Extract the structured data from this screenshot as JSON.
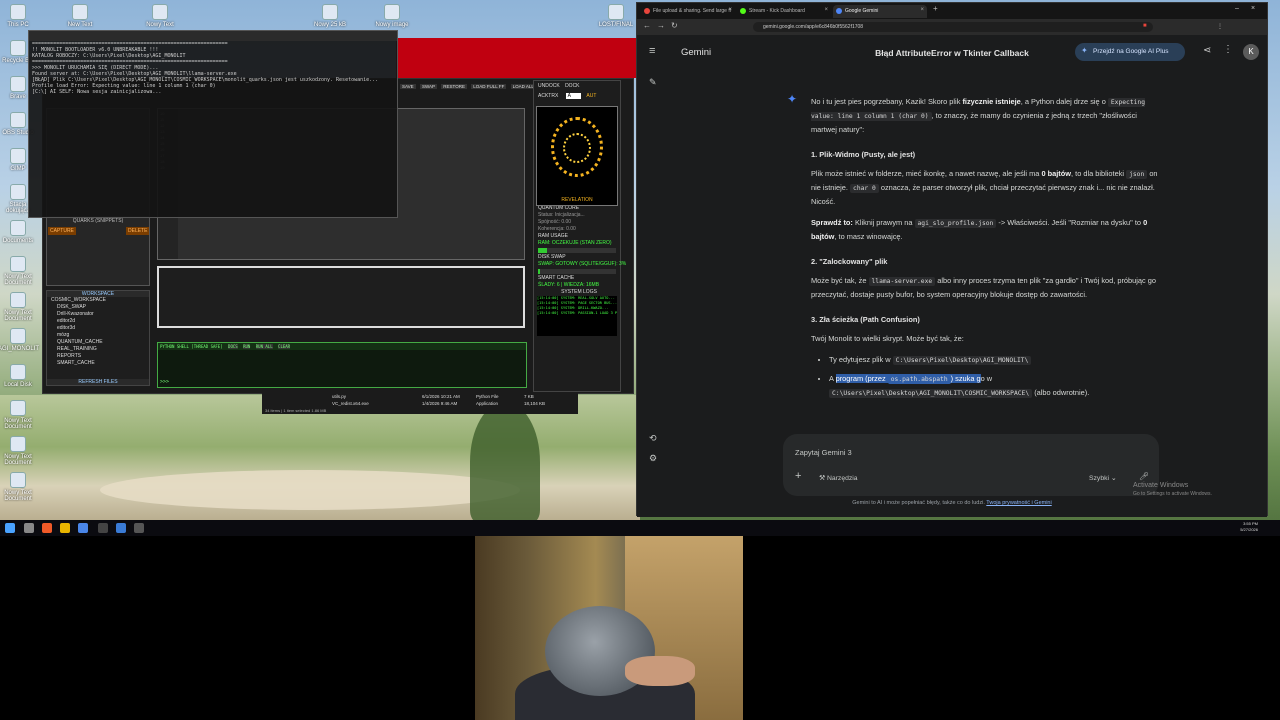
{
  "desktop": {
    "icons_left": [
      "This PC",
      "Recycle Bin",
      "Brave",
      "OBS Studio",
      "GIMP",
      "Stacja dokująca",
      "Documents",
      "Nowy Text Document",
      "Nowy Text Document",
      "AGI_MONOLIT",
      "Local Disk",
      "Nowy Text Document",
      "Nowy Text Document",
      "Nowy Text Document"
    ],
    "icons_top": [
      "New Text",
      "Nowy Text",
      "Nowy 25 kB",
      "Nowy image",
      "LOST/FINAL"
    ]
  },
  "terminal": {
    "lines": [
      "=================================================================",
      "!! MONOLIT BOOTLOADER v6.0 UNBREAKABLE !!!",
      "KATALOG ROBOCZY: C:\\Users\\Pixel\\Desktop\\AGI_MONOLIT",
      "=================================================================",
      ">>> MONOLIT URUCHAMIA SIĘ (DIRECT MODE)...",
      "Found server at: C:\\Users\\Pixel\\Desktop\\AGI_MONOLIT\\llama-server.exe",
      "[BŁĄD] Plik C:\\Users\\Pixel\\Desktop\\AGI_MONOLIT\\COSMIC_WORKSPACE\\monolit_quarks.json jest uszkodzony. Resetowanie...",
      "Profile load Error: Expecting value: line 1 column 1 (char 0)",
      "[C:\\] AI SELF: Nowa sesja zainicjalizowa..."
    ]
  },
  "monolit": {
    "toolbar": [
      "SAVE",
      "SWAP",
      "RESTORE",
      "LOAD FULL FF",
      "LOAD ALL"
    ],
    "quarks_title": "QUARKS (SNIPPETS)",
    "capture": "CAPTURE",
    "delete": "DELETE",
    "workspace_title": "WORKSPACE",
    "tree": [
      "COSMIC_WORKSPACE",
      "DISK_SWAP",
      "Drill-Kwazonator",
      "editor2d",
      "editor3d",
      "mózg",
      "QUANTUM_CACHE",
      "REAL_TRAINING",
      "REPORTS",
      "SMART_CACHE"
    ],
    "refresh": "REFRESH FILES",
    "shell_header": "PYTHON SHELL [THREAD SAFE]",
    "shell_buttons": [
      "DOCS",
      "RUN",
      "RUN ALL",
      "CLEAR"
    ],
    "shell_prompt": ">>>",
    "right": {
      "tabs": [
        "UNDOCK",
        "DOCK"
      ],
      "activate": "ACKTRX",
      "mode": "A",
      "auto": "AUT",
      "orb_label": "REVELATION",
      "quantum": "QUANTUM CORE",
      "status1": "Status: Inicjalizacja...",
      "status2": "Spójność: 0.00",
      "status3": "Koherencja: 0.00",
      "ram_title": "RAM USAGE",
      "ram_text": "RAM: OCZEKUJE (STAN ZERO)",
      "ram_fill": 0.12,
      "swap_title": "DISK SWAP",
      "swap_text": "SWAP: GOTOWY (SQLITE/GGUF): 3%",
      "swap_fill": 0.03,
      "cache_title": "SMART CACHE",
      "cache_text": "ŚLADY: 6 | WIEDZA: 16MB",
      "logs_title": "SYSTEM LOGS",
      "logs": [
        "[15:14:00] SYSTEM: REAL-SOLV AUTO...",
        "[15:14:00] SYSTEM: PAGE SECTOR BUS...",
        "[15:14:00] SYSTEM: DRILL-KWAZO...",
        "[15:14:00] SYSTEM: PASSION-1 LOAD 3 PUSH READY."
      ]
    },
    "explorer": {
      "files": [
        {
          "name": "utils.py",
          "date": "6/1/2026 10:21 AM",
          "type": "Python File",
          "size": "7 KB"
        },
        {
          "name": "VC_redist.x64.exe",
          "date": "1/4/2026 9:46 AM",
          "type": "Application",
          "size": "18,104 KB"
        }
      ],
      "status": "34 items  |  1 item selected  1.86 MB"
    }
  },
  "taskbar": {
    "time": "3:55 PM",
    "date": "5/27/2026"
  },
  "browser": {
    "tabs": [
      {
        "label": "File upload & sharing. Send large fi",
        "color": "#e8453c"
      },
      {
        "label": "Stream - Kick Dashboard",
        "color": "#53fc18"
      },
      {
        "label": "Google Gemini",
        "color": "#4e86f7"
      }
    ],
    "url": "gemini.google.com/app/e6c846b0f5562f1708"
  },
  "gemini": {
    "app_name": "Gemini",
    "chat_title": "Błąd AttributeError w Tkinter Callback",
    "upgrade": "Przejdź na Google AI Plus",
    "avatar_letter": "K",
    "intro_1": "No i tu jest pies pogrzebany, Kazik! Skoro plik ",
    "intro_b": "fizycznie istnieje",
    "intro_2": ", a Python dalej drze się o ",
    "intro_code": "Expecting value: line 1 column 1 (char 0)",
    "intro_3": ", to znaczy, że mamy do czynienia z jedną z trzech \"złośliwości martwej natury\":",
    "h1": "1. Plik-Widmo (Pusty, ale jest)",
    "p1_a": "Plik może istnieć w folderze, mieć ikonkę, a nawet nazwę, ale jeśli ma ",
    "p1_b": "0 bajtów",
    "p1_c": ", to dla biblioteki ",
    "p1_code1": "json",
    "p1_d": " on nie istnieje. ",
    "p1_code2": "char 0",
    "p1_e": " oznacza, że parser otworzył plik, chciał przeczytać pierwszy znak i... nic nie znalazł. Nicość.",
    "p2_b": "Sprawdź to:",
    "p2_a": " Kliknij prawym na ",
    "p2_code": "agi_slo_profile.json",
    "p2_c": " -> Właściwości. Jeśli \"Rozmiar na dysku\" to ",
    "p2_d": "0 bajtów",
    "p2_e": ", to masz winowajcę.",
    "h2": "2. \"Zalockowany\" plik",
    "p3_a": "Może być tak, że ",
    "p3_code": "llama-server.exe",
    "p3_b": " albo inny proces trzyma ten plik \"za gardło\" i Twój kod, próbując go przeczytać, dostaje pusty bufor, bo system operacyjny blokuje dostęp do zawartości.",
    "h3": "3. Zła ścieżka (Path Confusion)",
    "p4": "Twój Monolit to wielki skrypt. Może być tak, że:",
    "li1_a": "Ty edytujesz plik w ",
    "li1_code": "C:\\Users\\Pixel\\Desktop\\AGI_MONOLIT\\",
    "li2_a": "A ",
    "li2_hl1": "program (przez ",
    "li2_code": "os.path.abspath",
    "li2_hl2": ") szuka g",
    "li2_b": "o w",
    "li2_code2": "C:\\Users\\Pixel\\Desktop\\AGI_MONOLIT\\COSMIC_WORKSPACE\\",
    "li2_c": " (albo odwrotnie).",
    "prompt_placeholder": "Zapytaj Gemini 3",
    "tools": "Narzędzia",
    "mode": "Szybki",
    "disclaimer": "Gemini to AI i może popełniać błędy, także co do ludzi. ",
    "disclaimer_link": "Twoja prywatność i Gemini",
    "activate_title": "Activate Windows",
    "activate_sub": "Go to Settings to activate Windows."
  }
}
